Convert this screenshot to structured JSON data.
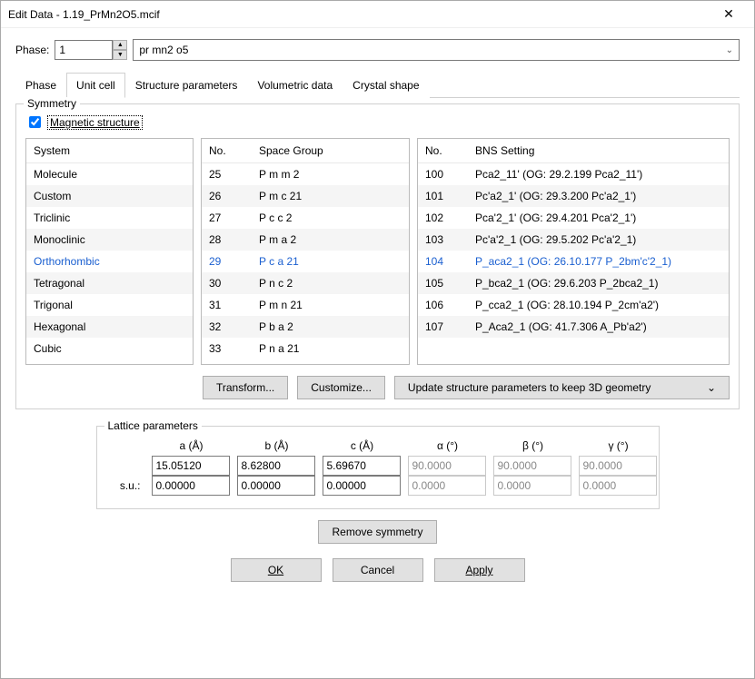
{
  "window": {
    "title": "Edit Data - 1.19_PrMn2O5.mcif"
  },
  "phase": {
    "label": "Phase:",
    "number": "1",
    "name": "pr mn2 o5"
  },
  "tabs": [
    "Phase",
    "Unit cell",
    "Structure parameters",
    "Volumetric data",
    "Crystal shape"
  ],
  "active_tab": 1,
  "symmetry": {
    "title": "Symmetry",
    "magnetic_label": "Magnetic structure",
    "magnetic_checked": true,
    "system_header": "System",
    "systems": [
      "Molecule",
      "Custom",
      "Triclinic",
      "Monoclinic",
      "Orthorhombic",
      "Tetragonal",
      "Trigonal",
      "Hexagonal",
      "Cubic"
    ],
    "system_selected": "Orthorhombic",
    "sg_headers": {
      "no": "No.",
      "name": "Space Group"
    },
    "space_groups": [
      {
        "no": "25",
        "name": "P m m 2"
      },
      {
        "no": "26",
        "name": "P m c 21"
      },
      {
        "no": "27",
        "name": "P c c 2"
      },
      {
        "no": "28",
        "name": "P m a 2"
      },
      {
        "no": "29",
        "name": "P c a 21"
      },
      {
        "no": "30",
        "name": "P n c 2"
      },
      {
        "no": "31",
        "name": "P m n 21"
      },
      {
        "no": "32",
        "name": "P b a 2"
      },
      {
        "no": "33",
        "name": "P n a 21"
      }
    ],
    "sg_selected": "29",
    "bns_headers": {
      "no": "No.",
      "name": "BNS Setting"
    },
    "bns_settings": [
      {
        "no": "100",
        "name": "Pca2_11' (OG: 29.2.199 Pca2_11')"
      },
      {
        "no": "101",
        "name": "Pc'a2_1' (OG: 29.3.200 Pc'a2_1')"
      },
      {
        "no": "102",
        "name": "Pca'2_1' (OG: 29.4.201 Pca'2_1')"
      },
      {
        "no": "103",
        "name": "Pc'a'2_1 (OG: 29.5.202 Pc'a'2_1)"
      },
      {
        "no": "104",
        "name": "P_aca2_1 (OG: 26.10.177 P_2bm'c'2_1)"
      },
      {
        "no": "105",
        "name": "P_bca2_1 (OG: 29.6.203 P_2bca2_1)"
      },
      {
        "no": "106",
        "name": "P_cca2_1 (OG: 28.10.194 P_2cm'a2')"
      },
      {
        "no": "107",
        "name": "P_Aca2_1 (OG: 41.7.306 A_Pb'a2')"
      }
    ],
    "bns_selected": "104",
    "transform_label": "Transform...",
    "customize_label": "Customize...",
    "update_label": "Update structure parameters to keep 3D geometry"
  },
  "lattice": {
    "title": "Lattice parameters",
    "headers": [
      "a (Å)",
      "b (Å)",
      "c (Å)",
      "α (°)",
      "β (°)",
      "γ (°)"
    ],
    "values": [
      "15.05120",
      "8.62800",
      "5.69670",
      "90.0000",
      "90.0000",
      "90.0000"
    ],
    "su_label": "s.u.:",
    "su_values": [
      "0.00000",
      "0.00000",
      "0.00000",
      "0.0000",
      "0.0000",
      "0.0000"
    ],
    "angle_disabled": true
  },
  "remove_symmetry_label": "Remove symmetry",
  "buttons": {
    "ok": "OK",
    "cancel": "Cancel",
    "apply": "Apply"
  }
}
